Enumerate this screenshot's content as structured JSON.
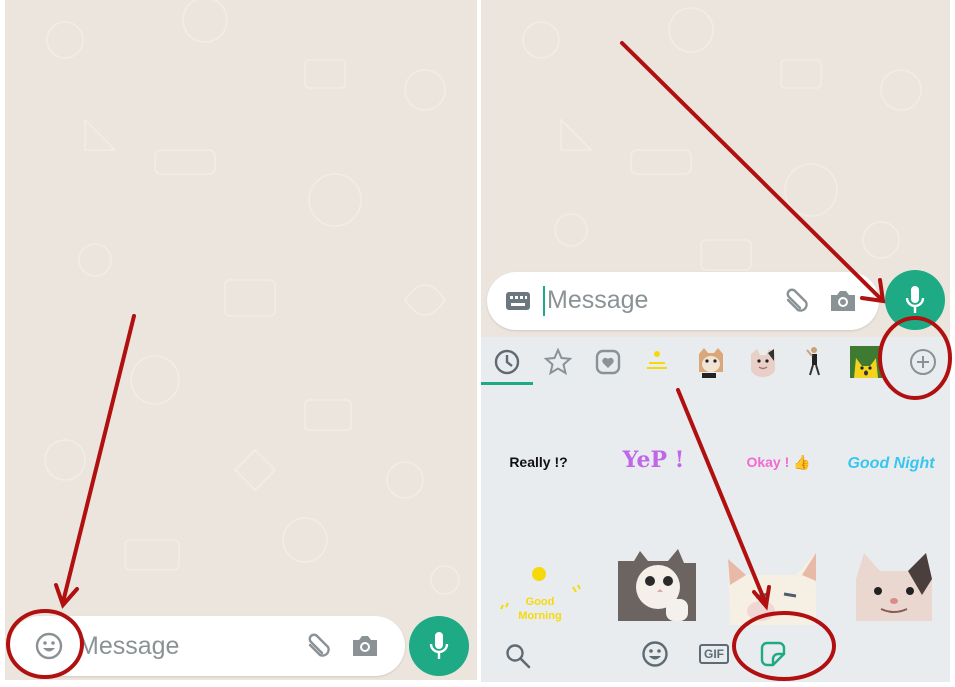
{
  "left_panel": {
    "input": {
      "placeholder": "Message",
      "left_icon": "emoji-icon",
      "attach_icon": "paperclip-icon",
      "camera_icon": "camera-icon"
    },
    "send_button_icon": "microphone-icon"
  },
  "right_panel": {
    "input": {
      "placeholder": "Message",
      "left_icon": "keyboard-icon",
      "attach_icon": "paperclip-icon",
      "camera_icon": "camera-icon"
    },
    "send_button_icon": "microphone-icon",
    "sticker_tabs": [
      {
        "name": "recent",
        "icon": "clock-icon",
        "active": true
      },
      {
        "name": "favorites",
        "icon": "star-icon"
      },
      {
        "name": "love",
        "icon": "heart-sticker-icon"
      },
      {
        "name": "good-morning-pack",
        "icon": "sun-sticker-thumbnail"
      },
      {
        "name": "cat-pack-1",
        "icon": "cat-sticker-thumbnail"
      },
      {
        "name": "cat-pack-2",
        "icon": "cat-sticker-thumbnail"
      },
      {
        "name": "dancer-pack",
        "icon": "dancer-sticker-thumbnail"
      },
      {
        "name": "pikachu-pack",
        "icon": "pikachu-sticker-thumbnail"
      },
      {
        "name": "add",
        "icon": "plus-circle-icon"
      }
    ],
    "stickers": [
      {
        "text": "Really !?",
        "color": "#111111"
      },
      {
        "text": "YeP !",
        "color": "#c066e8"
      },
      {
        "text": "Okay ! 👍",
        "color": "#f06ad2"
      },
      {
        "text": "Good Night",
        "color": "#36c6f0"
      },
      {
        "text": "Good Morning",
        "color": "#f5d90a"
      },
      {
        "text": "",
        "kind": "cat-thumbs-up"
      },
      {
        "text": "",
        "kind": "white-cat-squint"
      },
      {
        "text": "",
        "kind": "smiling-cat"
      }
    ],
    "bottom_bar": {
      "search_icon": "search-icon",
      "emoji_icon": "emoji-icon",
      "gif_label": "GIF",
      "sticker_icon": "sticker-icon"
    }
  },
  "colors": {
    "accent_green": "#1daa84",
    "annotation_red": "#b01010",
    "wallpaper": "#ece5dd",
    "tray": "#e9ecef",
    "icon_gray": "#6b7880"
  }
}
